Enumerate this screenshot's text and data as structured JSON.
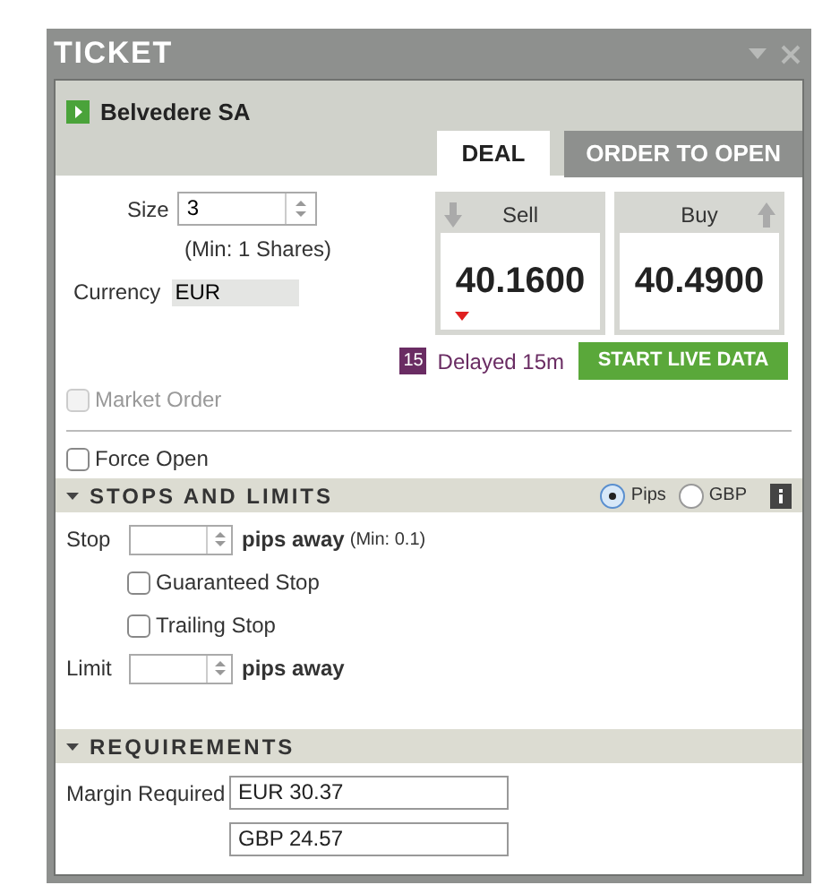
{
  "window": {
    "title": "TICKET"
  },
  "instrument": {
    "name": "Belvedere SA"
  },
  "tabs": [
    {
      "label": "DEAL",
      "selected": true
    },
    {
      "label": "ORDER TO OPEN",
      "selected": false
    }
  ],
  "deal": {
    "size": {
      "label": "Size",
      "value": "3",
      "hint": "(Min: 1 Shares)"
    },
    "currency": {
      "label": "Currency",
      "value": "EUR"
    },
    "prices": [
      {
        "kind": "sell",
        "label": "Sell",
        "value": "40.1600"
      },
      {
        "kind": "buy",
        "label": "Buy",
        "value": "40.4900"
      }
    ],
    "delay_badge": "15",
    "delay_text": "Delayed 15m",
    "live_button": "START LIVE DATA",
    "options": [
      {
        "label": "Market Order",
        "checked": false,
        "disabled": true
      },
      {
        "label": "Force Open",
        "checked": false,
        "disabled": false
      }
    ]
  },
  "stops_and_limits": {
    "title": "STOPS AND LIMITS",
    "expanded": true,
    "units": [
      {
        "label": "Pips",
        "selected": true
      },
      {
        "label": "GBP",
        "selected": false
      }
    ],
    "stop": {
      "label": "Stop",
      "unit": "pips away",
      "hint": "(Min: 0.1)"
    },
    "stop_options": [
      {
        "label": "Guaranteed Stop",
        "checked": false
      },
      {
        "label": "Trailing Stop",
        "checked": false
      }
    ],
    "limit": {
      "label": "Limit",
      "unit": "pips away"
    }
  },
  "requirements": {
    "title": "REQUIREMENTS",
    "expanded": true,
    "label": "Margin Required",
    "values": [
      "EUR 30.37",
      "GBP 24.57"
    ]
  }
}
